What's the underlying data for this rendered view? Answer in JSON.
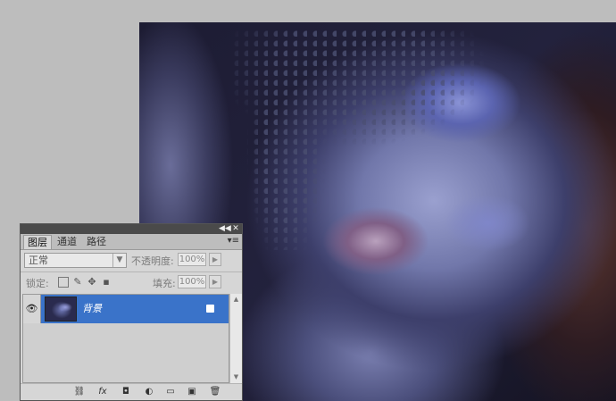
{
  "panel": {
    "tabs": [
      {
        "label": "图层",
        "active": true
      },
      {
        "label": "通道",
        "active": false
      },
      {
        "label": "路径",
        "active": false
      }
    ],
    "blend_mode": "正常",
    "opacity_label": "不透明度:",
    "opacity_value": "100%",
    "lock_label": "锁定:",
    "fill_label": "填充:",
    "fill_value": "100%",
    "layers": [
      {
        "name": "背景",
        "visible": true,
        "locked": true,
        "selected": true
      }
    ],
    "titlebar_collapse": "◀◀",
    "titlebar_close": "✕",
    "menu_icon": "▾≡",
    "bottom_icons": [
      "link-icon",
      "fx-icon",
      "mask-icon",
      "adjustment-icon",
      "folder-icon",
      "new-layer-icon",
      "trash-icon"
    ]
  },
  "colors": {
    "selection": "#3a73c9",
    "workspace": "#bdbdbd",
    "panel_bg": "#d6d6d6"
  }
}
